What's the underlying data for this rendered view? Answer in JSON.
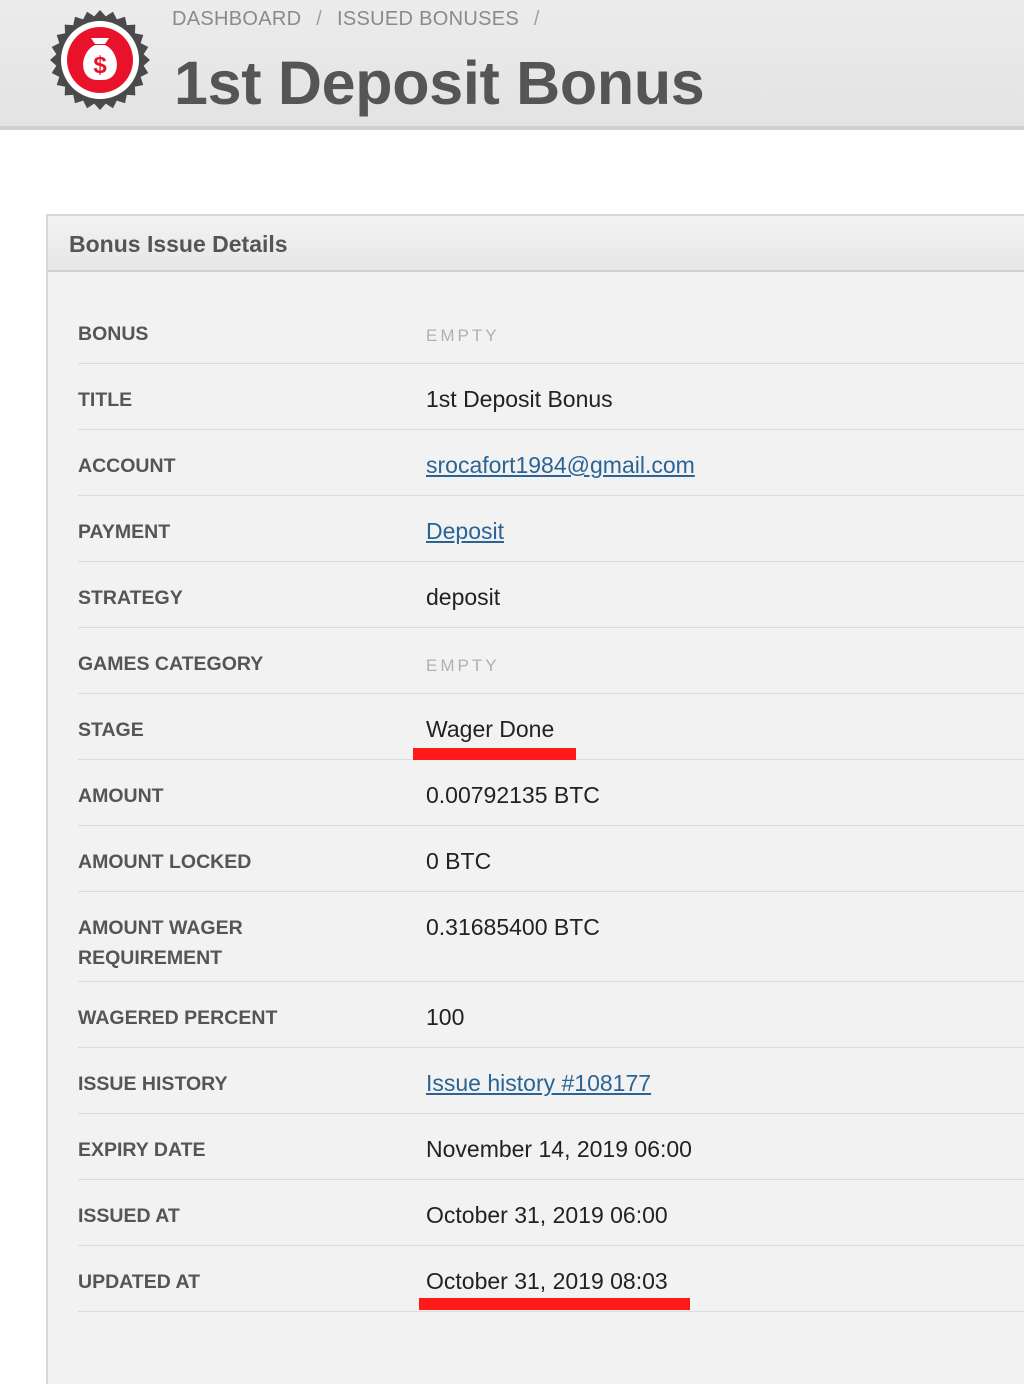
{
  "header": {
    "breadcrumb": [
      "DASHBOARD",
      "ISSUED BONUSES"
    ],
    "breadcrumb_separator": "/",
    "title": "1st Deposit Bonus",
    "logo_icon": "money-bag-dollar-icon",
    "logo_color": "#e8132b"
  },
  "panel": {
    "title": "Bonus Issue Details"
  },
  "details": [
    {
      "label": "BONUS",
      "value": "EMPTY",
      "type": "empty"
    },
    {
      "label": "TITLE",
      "value": "1st Deposit Bonus",
      "type": "text"
    },
    {
      "label": "ACCOUNT",
      "value": "srocafort1984@gmail.com",
      "type": "link"
    },
    {
      "label": "PAYMENT",
      "value": "Deposit",
      "type": "link"
    },
    {
      "label": "STRATEGY",
      "value": "deposit",
      "type": "text"
    },
    {
      "label": "GAMES CATEGORY",
      "value": "EMPTY",
      "type": "empty"
    },
    {
      "label": "STAGE",
      "value": "Wager Done",
      "type": "text",
      "highlighted": true
    },
    {
      "label": "AMOUNT",
      "value": "0.00792135 BTC",
      "type": "text"
    },
    {
      "label": "AMOUNT LOCKED",
      "value": "0 BTC",
      "type": "text"
    },
    {
      "label": "AMOUNT WAGER REQUIREMENT",
      "value": "0.31685400 BTC",
      "type": "text"
    },
    {
      "label": "WAGERED PERCENT",
      "value": "100",
      "type": "text"
    },
    {
      "label": "ISSUE HISTORY",
      "value": "Issue history #108177",
      "type": "link"
    },
    {
      "label": "EXPIRY DATE",
      "value": "November 14, 2019 06:00",
      "type": "text"
    },
    {
      "label": "ISSUED AT",
      "value": "October 31, 2019 06:00",
      "type": "text"
    },
    {
      "label": "UPDATED AT",
      "value": "October 31, 2019 08:03",
      "type": "text",
      "highlighted": true
    }
  ],
  "colors": {
    "link": "#2a6496",
    "highlight_marker": "#ff1a1a"
  }
}
